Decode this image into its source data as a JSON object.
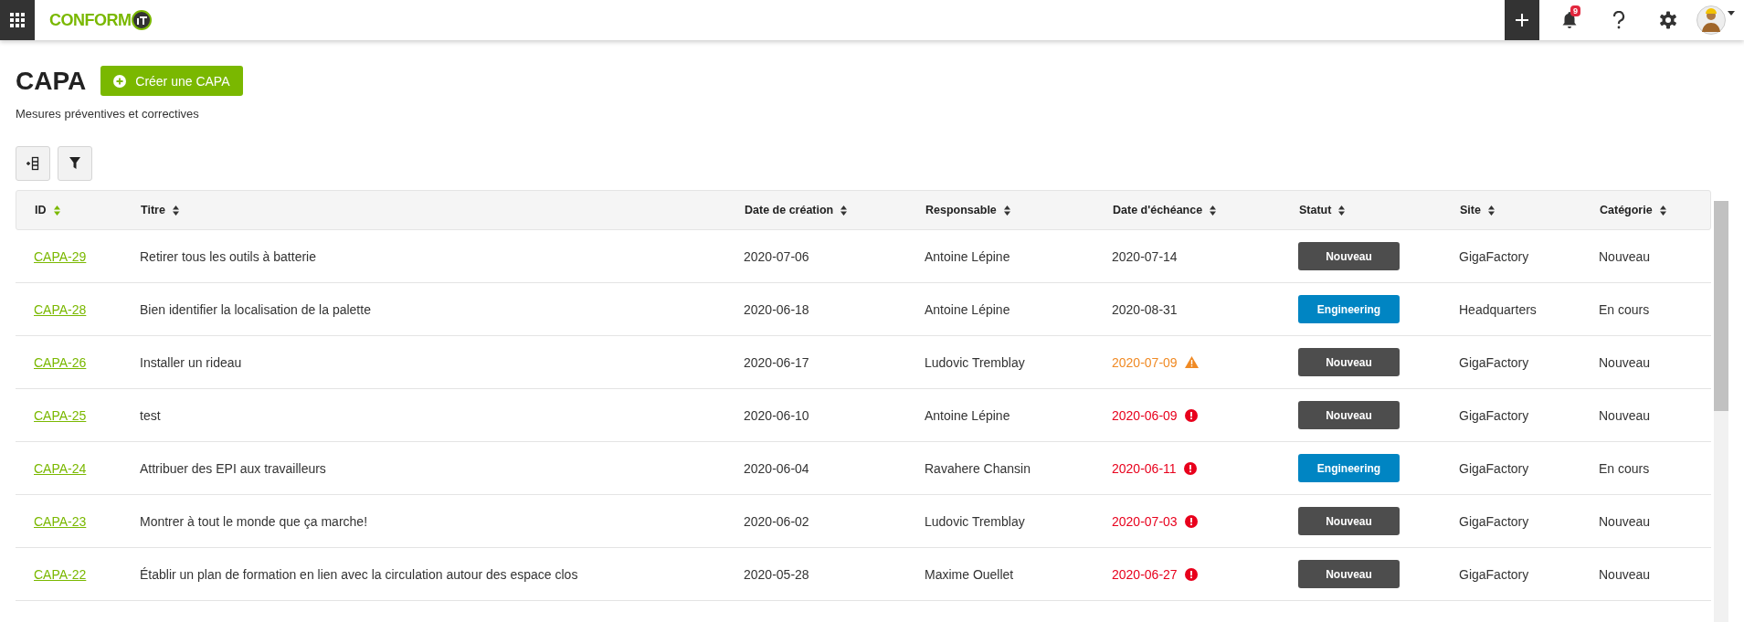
{
  "topbar": {
    "logo": "CONFORM",
    "notifications": {
      "count": "9"
    }
  },
  "page": {
    "title": "CAPA",
    "create_button": "Créer une CAPA",
    "subtitle": "Mesures préventives et correctives"
  },
  "table": {
    "columns": [
      "ID",
      "Titre",
      "Date de création",
      "Responsable",
      "Date d'échéance",
      "Statut",
      "Site",
      "Catégorie"
    ],
    "rows": [
      {
        "id": "CAPA-29",
        "title": "Retirer tous les outils à batterie",
        "created": "2020-07-06",
        "owner": "Antoine Lépine",
        "due": "2020-07-14",
        "kind": "normal",
        "status": {
          "label": "Nouveau",
          "color": "#4d4d4d"
        },
        "site": "GigaFactory",
        "category": "Nouveau"
      },
      {
        "id": "CAPA-28",
        "title": "Bien identifier la localisation de la palette",
        "created": "2020-06-18",
        "owner": "Antoine Lépine",
        "due": "2020-08-31",
        "kind": "normal",
        "status": {
          "label": "Engineering",
          "color": "#0085c3"
        },
        "site": "Headquarters",
        "category": "En cours"
      },
      {
        "id": "CAPA-26",
        "title": "Installer un rideau",
        "created": "2020-06-17",
        "owner": "Ludovic Tremblay",
        "due": "2020-07-09",
        "kind": "warning",
        "status": {
          "label": "Nouveau",
          "color": "#4d4d4d"
        },
        "site": "GigaFactory",
        "category": "Nouveau"
      },
      {
        "id": "CAPA-25",
        "title": "test",
        "created": "2020-06-10",
        "owner": "Antoine Lépine",
        "due": "2020-06-09",
        "kind": "overdue",
        "status": {
          "label": "Nouveau",
          "color": "#4d4d4d"
        },
        "site": "GigaFactory",
        "category": "Nouveau"
      },
      {
        "id": "CAPA-24",
        "title": "Attribuer des EPI aux travailleurs",
        "created": "2020-06-04",
        "owner": "Ravahere Chansin",
        "due": "2020-06-11",
        "kind": "overdue",
        "status": {
          "label": "Engineering",
          "color": "#0085c3"
        },
        "site": "GigaFactory",
        "category": "En cours"
      },
      {
        "id": "CAPA-23",
        "title": "Montrer à tout le monde que ça marche!",
        "created": "2020-06-02",
        "owner": "Ludovic Tremblay",
        "due": "2020-07-03",
        "kind": "overdue",
        "status": {
          "label": "Nouveau",
          "color": "#4d4d4d"
        },
        "site": "GigaFactory",
        "category": "Nouveau"
      },
      {
        "id": "CAPA-22",
        "title": "Établir un plan de formation en lien avec la circulation autour des espace clos",
        "created": "2020-05-28",
        "owner": "Maxime Ouellet",
        "due": "2020-06-27",
        "kind": "overdue",
        "status": {
          "label": "Nouveau",
          "color": "#4d4d4d"
        },
        "site": "GigaFactory",
        "category": "Nouveau"
      }
    ]
  }
}
